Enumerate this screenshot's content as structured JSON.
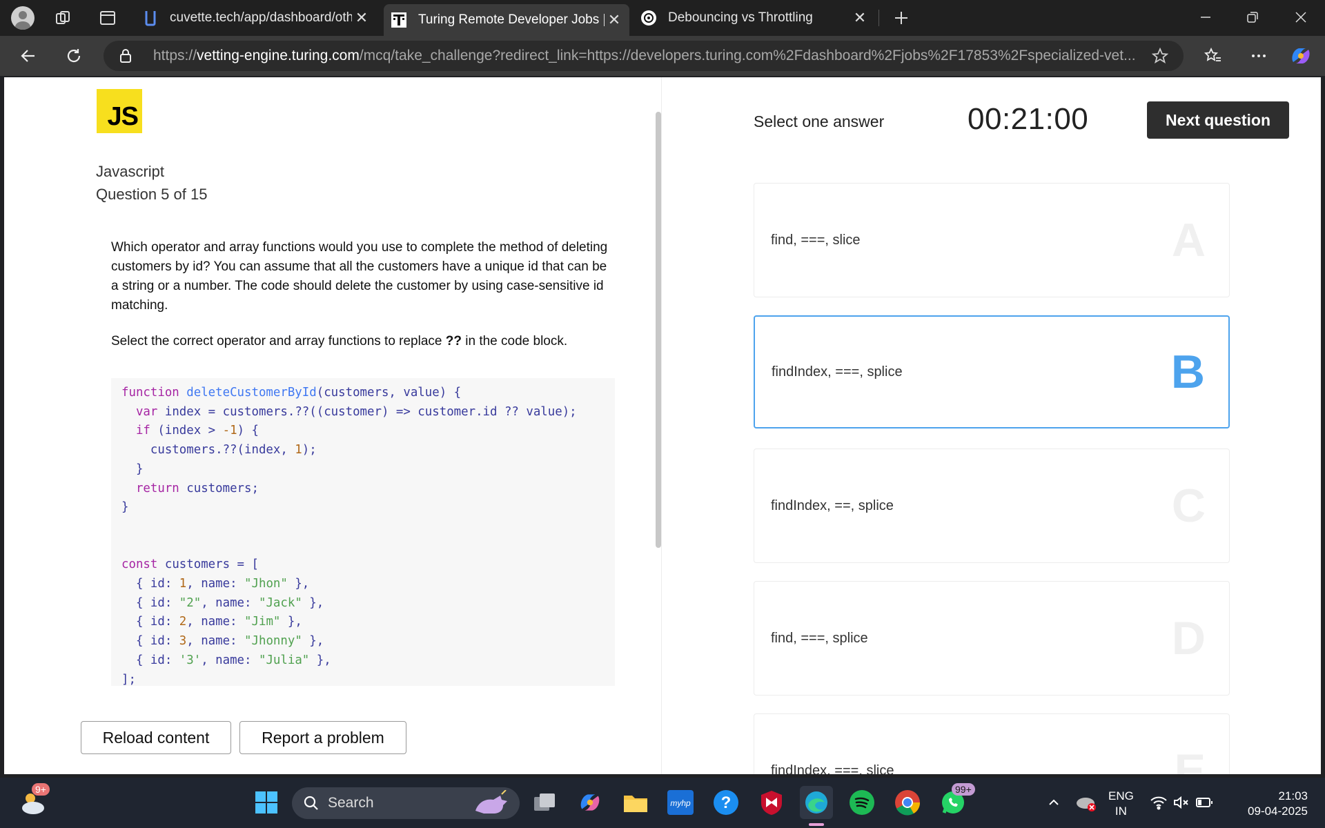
{
  "browser": {
    "tabs": [
      {
        "title": "cuvette.tech/app/dashboard/othe",
        "icon": "cuvette-favicon-icon"
      },
      {
        "title": "Turing Remote Developer Jobs | A",
        "icon": "turing-favicon-icon"
      },
      {
        "title": "Debouncing vs Throttling",
        "icon": "chatgpt-favicon-icon"
      }
    ],
    "url_prefix": "https://",
    "url_host": "vetting-engine.turing.com",
    "url_rest": "/mcq/take_challenge?redirect_link=https://developers.turing.com%2Fdashboard%2Fjobs%2F17853%2Fspecialized-vet..."
  },
  "left": {
    "logo_text": "JS",
    "subject": "Javascript",
    "question_number": "Question 5 of 15",
    "question_text": "Which operator and array functions would you use to complete the method of deleting customers by id? You can assume that all the customers have a unique id that can be a string or a number. The code should delete the customer by using case-sensitive id matching.",
    "instruction_before": "Select the correct operator and array functions to replace ",
    "instruction_bold": "??",
    "instruction_after": " in the code block.",
    "reload_label": "Reload content",
    "report_label": "Report a problem"
  },
  "right": {
    "select_label": "Select one answer",
    "timer": "00:21:00",
    "next_label": "Next question",
    "options": [
      {
        "letter": "A",
        "text": "find, ===, slice"
      },
      {
        "letter": "B",
        "text": "findIndex, ===, splice"
      },
      {
        "letter": "C",
        "text": "findIndex, ==, splice"
      },
      {
        "letter": "D",
        "text": "find, ===, splice"
      },
      {
        "letter": "E",
        "text": "findIndex, ===, slice"
      }
    ],
    "selected": "B"
  },
  "taskbar": {
    "weather_badge": "9+",
    "search_placeholder": "Search",
    "whatsapp_badge": "99+",
    "lang_line1": "ENG",
    "lang_line2": "IN",
    "time": "21:03",
    "date": "09-04-2025"
  },
  "colors": {
    "accent": "#4da3ed",
    "js_yellow": "#f7df1e",
    "dark_button": "#2e2e2e"
  }
}
